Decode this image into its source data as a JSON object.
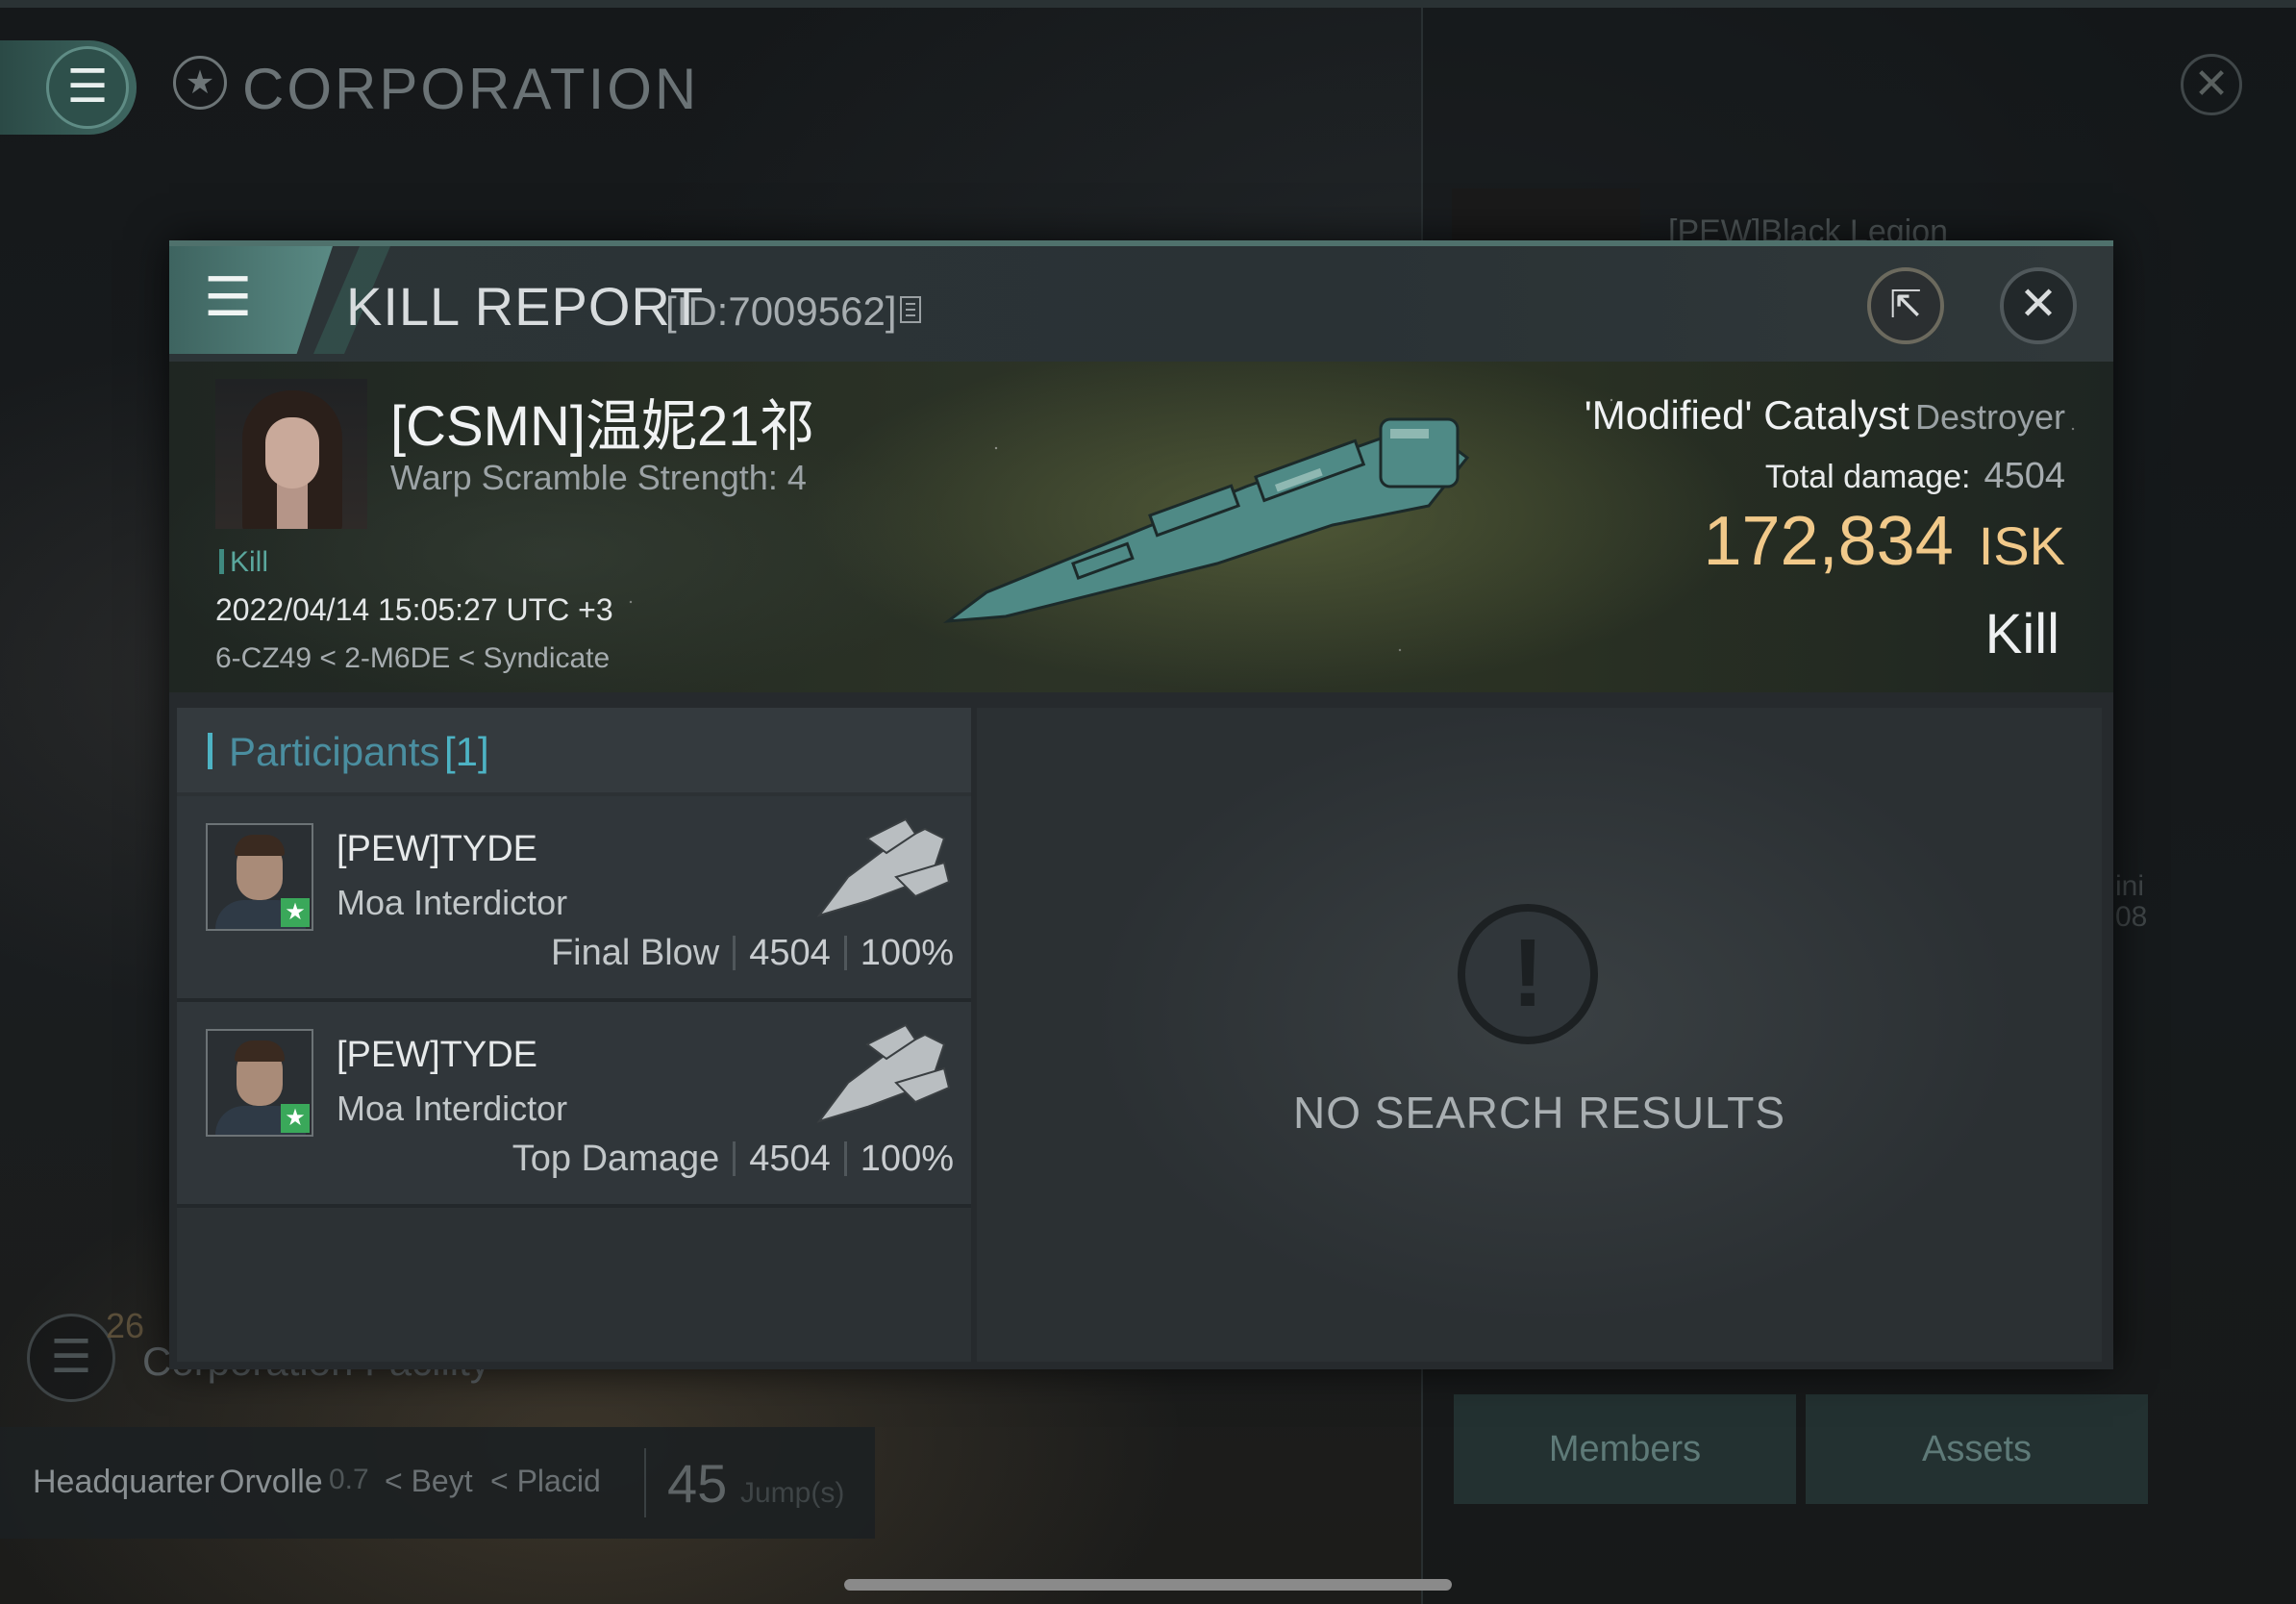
{
  "background": {
    "corp_title": "CORPORATION",
    "legion_text": "[PEW]Black Legion",
    "side_text_1": "ini",
    "side_text_2": "08",
    "facility_count": "26",
    "facility_label": "Corporation Facility",
    "hq_label": "Headquarter",
    "hq_system": "Orvolle",
    "hq_security": "0.7",
    "hq_route_1": "Beyt",
    "hq_route_2": "Placid",
    "jumps_value": "45",
    "jumps_label": "Jump(s)",
    "members_button": "Members",
    "assets_button": "Assets"
  },
  "kill_report": {
    "title": "KILL REPORT",
    "id_text": "[ID:7009562]",
    "victim": {
      "name": "[CSMN]温妮21祁",
      "warp_scramble": "Warp Scramble Strength: 4",
      "tag": "Kill",
      "datetime": "2022/04/14 15:05:27 UTC +3",
      "location": "6-CZ49 < 2-M6DE < Syndicate",
      "ship_name": "'Modified' Catalyst",
      "ship_class": "Destroyer",
      "total_damage_label": "Total damage:",
      "total_damage_value": "4504",
      "isk_value": "172,834",
      "isk_unit": "ISK",
      "result_label": "Kill"
    },
    "participants": {
      "title": "Participants",
      "count": "[1]",
      "rows": [
        {
          "name": "[PEW]TYDE",
          "ship": "Moa Interdictor",
          "role": "Final Blow",
          "damage": "4504",
          "percent": "100%"
        },
        {
          "name": "[PEW]TYDE",
          "ship": "Moa Interdictor",
          "role": "Top Damage",
          "damage": "4504",
          "percent": "100%"
        }
      ]
    },
    "results_panel": {
      "empty_text": "NO SEARCH RESULTS"
    }
  },
  "colors": {
    "accent_teal": "#4f716c",
    "isk_gold": "#f1c98a",
    "participants_blue": "#4db3c4",
    "badge_green": "#3aa85a"
  },
  "icons": {
    "menu": "hamburger-icon",
    "close": "close-icon",
    "share": "share-icon",
    "copy": "copy-icon",
    "corp_logo": "corporation-star-icon",
    "warning": "exclamation-icon",
    "standing": "star-badge-icon"
  }
}
